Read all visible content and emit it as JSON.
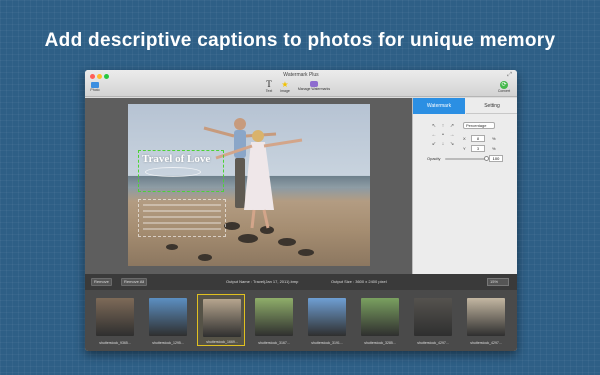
{
  "headline": "Add descriptive captions to photos for unique memory",
  "window": {
    "title": "Watermark Plus"
  },
  "toolbar": {
    "photo_label": "Photo",
    "text_label": "Text",
    "image_label": "Image",
    "manage_label": "Manage Watermarks",
    "convert_label": "Convert"
  },
  "watermark": {
    "title_text": "Travel of Love"
  },
  "panel": {
    "tab_watermark": "Watermark",
    "tab_setting": "Setting",
    "position_unit": "Percentage",
    "x_label": "X",
    "x_value": "8",
    "y_label": "Y",
    "y_value": "3",
    "percent_sign": "%",
    "opacity_label": "Opacity",
    "opacity_value": "100",
    "opacity_fraction": 1.0
  },
  "bottom_bar": {
    "remove_label": "Remove",
    "remove_all_label": "Remove All",
    "output_name": "Output Name : Travel(Jan 17, 2011).bmp",
    "output_size": "Output Size : 3600 x 2400 pixel",
    "zoom_value": "15%"
  },
  "thumbnails": [
    {
      "label": "shutterstock_9365...",
      "color": "#7d6a58"
    },
    {
      "label": "shutterstock_1295...",
      "color": "#5c8fc2"
    },
    {
      "label": "shutterstock_1669...",
      "color": "#b6a58e",
      "selected": true
    },
    {
      "label": "shutterstock_3167...",
      "color": "#8fae6a"
    },
    {
      "label": "shutterstock_3191...",
      "color": "#6f9fd4"
    },
    {
      "label": "shutterstock_3285...",
      "color": "#7aa060"
    },
    {
      "label": "shutterstock_4297...",
      "color": "#55524e"
    },
    {
      "label": "shutterstock_4297...",
      "color": "#c4b7a2"
    }
  ],
  "colors": {
    "accent": "#2b8fe3",
    "selection": "#e0c020",
    "watermark_guide": "#4cd137"
  }
}
